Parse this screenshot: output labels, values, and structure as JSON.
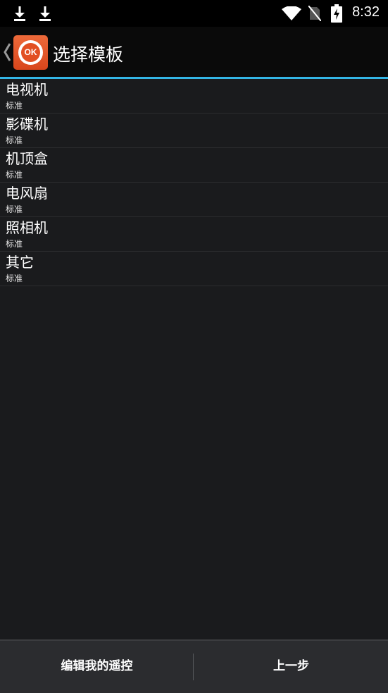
{
  "status_bar": {
    "time": "8:32",
    "icons": [
      "download-icon",
      "download-icon",
      "wifi-icon",
      "no-sim-icon",
      "battery-charging-icon"
    ]
  },
  "action_bar": {
    "title": "选择模板",
    "logo_text": "OK",
    "accent_color": "#33b5e5"
  },
  "templates": [
    {
      "title": "电视机",
      "subtitle": "标准"
    },
    {
      "title": "影碟机",
      "subtitle": "标准"
    },
    {
      "title": "机顶盒",
      "subtitle": "标准"
    },
    {
      "title": "电风扇",
      "subtitle": "标准"
    },
    {
      "title": "照相机",
      "subtitle": "标准"
    },
    {
      "title": "其它",
      "subtitle": "标准"
    }
  ],
  "bottom_bar": {
    "left_label": "编辑我的遥控",
    "right_label": "上一步"
  }
}
